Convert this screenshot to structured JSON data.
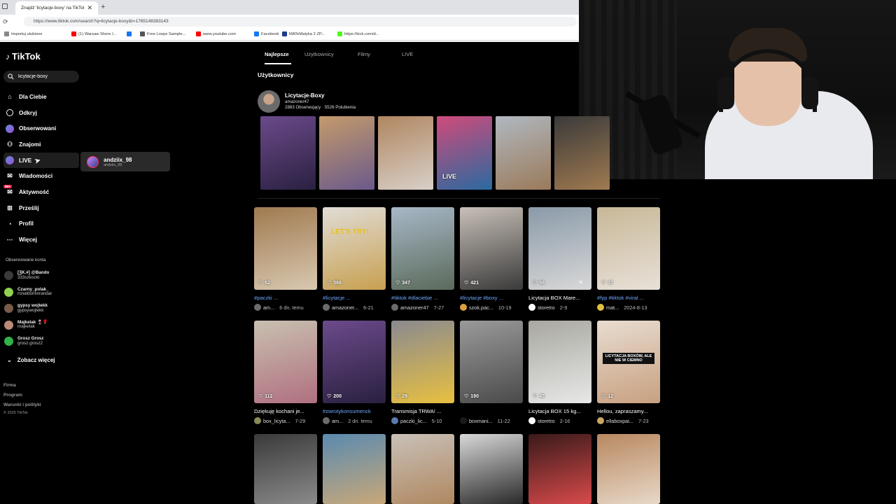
{
  "browser": {
    "tab_title": "Znajdź 'licytacje-boxy' na TikTok |",
    "tab_close": "✕",
    "new_tab": "+",
    "reload": "⟳",
    "url": "https://www.tiktok.com/search?q=licytacje-boxy&t=1765148383143",
    "bookmarks": [
      {
        "label": "Importuj ulubione",
        "color": "#888888"
      },
      {
        "label": "(1) Warsaw Shore I...",
        "color": "#ff0000"
      },
      {
        "label": "",
        "color": "#1877f2"
      },
      {
        "label": "Free Loops Sample...",
        "color": "#555555"
      },
      {
        "label": "www.youtube.com",
        "color": "#ff0000"
      },
      {
        "label": "Facebook",
        "color": "#1877f2"
      },
      {
        "label": "MATeMatyka 2 ZP...",
        "color": "#1a3d8f"
      },
      {
        "label": "https://kick.com/d...",
        "color": "#53fc18"
      }
    ]
  },
  "app": {
    "name": "TikTok",
    "search_value": "licytacje-boxy"
  },
  "sidebar": {
    "nav": [
      {
        "label": "Dla Ciebie",
        "icon": "home-icon"
      },
      {
        "label": "Odkryj",
        "icon": "compass-icon"
      },
      {
        "label": "Obserwowani",
        "icon": "avatar-icon"
      },
      {
        "label": "Znajomi",
        "icon": "friends-icon"
      },
      {
        "label": "LIVE",
        "icon": "live-icon"
      },
      {
        "label": "Wiadomości",
        "icon": "messages-icon"
      },
      {
        "label": "Aktywność",
        "icon": "activity-icon",
        "badge": "99+"
      },
      {
        "label": "Prześlij",
        "icon": "upload-icon"
      },
      {
        "label": "Profil",
        "icon": "profile-icon"
      },
      {
        "label": "Więcej",
        "icon": "more-icon"
      }
    ],
    "live_popup": {
      "name": "andziix_98",
      "user": "andziix_98"
    },
    "following_title": "Obserwowane konta",
    "following": [
      {
        "name": "[ƷK.#] @Bando",
        "user": "333szkocki",
        "color": "#3a3a3a"
      },
      {
        "name": "Czarny_polak_",
        "user": "ronaldominrandar",
        "color": "#8fd14f"
      },
      {
        "name": "gypsy wojtekk",
        "user": "gypsywojtekk",
        "color": "#7a5a4a"
      },
      {
        "name": "Majkelak 🍷🌹",
        "user": "majkelak",
        "color": "#b98a78"
      },
      {
        "name": "Grosz Grosz",
        "user": "grosz.grosz2",
        "color": "#2fb34a"
      }
    ],
    "see_more": "Zobacz więcej",
    "footer": [
      "Firma",
      "Program",
      "Warunki i polityki"
    ],
    "copyright": "© 2025 TikTok"
  },
  "main": {
    "tabs": [
      "Najlepsze",
      "Użytkownicy",
      "Filmy",
      "LIVE"
    ],
    "section_title": "Użytkownicy",
    "user": {
      "name": "Licytacje-Boxy",
      "handle": "amazoner47",
      "stats": "2883 Obserwujący · 5526 Polubienia"
    },
    "strip": [
      {
        "colors": [
          "#6b4a8a",
          "#2a2040"
        ],
        "live": ""
      },
      {
        "colors": [
          "#c49a6c",
          "#6a5a8a"
        ],
        "live": ""
      },
      {
        "colors": [
          "#b08660",
          "#d8d0c8"
        ],
        "live": ""
      },
      {
        "colors": [
          "#d04a7a",
          "#2a6aa0"
        ],
        "live": "LIVE"
      },
      {
        "colors": [
          "#b0b8c0",
          "#9a7a5a"
        ],
        "live": ""
      },
      {
        "colors": [
          "#3a3a3a",
          "#a07a50"
        ],
        "live": ""
      }
    ],
    "videos": [
      {
        "likes": "62",
        "title": "#paczki ...",
        "author": "am...",
        "date": "6 dn. temu",
        "colors": [
          "#a07a50",
          "#d8c8b0"
        ],
        "avatar": "#6b6b6b"
      },
      {
        "likes": "568",
        "title": "#licytacje ...",
        "author": "amazoner...",
        "date": "6-21",
        "colors": [
          "#e0dcd6",
          "#c8a050"
        ],
        "avatar": "#6b6b6b",
        "overlay": "LET'S TRY!"
      },
      {
        "likes": "347",
        "title": "#tiktok #dlaciebie ...",
        "author": "amazoner47",
        "date": "7-27",
        "colors": [
          "#a8b8c8",
          "#5a6a5a"
        ],
        "avatar": "#6b6b6b"
      },
      {
        "likes": "421",
        "title": "#licytacje #boxy ...",
        "author": "szok.pac...",
        "date": "10-19",
        "colors": [
          "#c8c0b8",
          "#3a3a3a"
        ],
        "avatar": "#d8a040"
      },
      {
        "likes": "58",
        "title": "Licytacja BOX Mare...",
        "author": "storetro",
        "date": "2-9",
        "colors": [
          "#8a9aa8",
          "#d8d8d8"
        ],
        "avatar": "#ffffff",
        "mute": true
      },
      {
        "likes": "37",
        "title": "#fyp #tiktok #viral ...",
        "author": "mat...",
        "date": "2024-8-13",
        "colors": [
          "#c8b898",
          "#e8e0d8"
        ],
        "avatar": "#e0c040"
      },
      {
        "likes": "112",
        "title": "Dziękuję kochani je...",
        "author": "box_licyta...",
        "date": "7-29",
        "colors": [
          "#c8c0b0",
          "#b07080"
        ],
        "avatar": "#8a8a5a"
      },
      {
        "likes": "200",
        "title": "#zwrotykonsumenck",
        "author": "am...",
        "date": "2 dn. temu",
        "colors": [
          "#6b4a8a",
          "#2a2040"
        ],
        "avatar": "#6b6b6b",
        "blue": true
      },
      {
        "likes": "29",
        "title": "Transmisja TRWA! ...",
        "author": "paczki_lic...",
        "date": "5-10",
        "colors": [
          "#8a8a90",
          "#e8c040"
        ],
        "avatar": "#5a7ab0"
      },
      {
        "likes": "190",
        "title": "",
        "author": "boxmani...",
        "date": "11-22",
        "colors": [
          "#9a9a9a",
          "#4a4a4a"
        ],
        "avatar": "#1a1a1a"
      },
      {
        "likes": "45",
        "title": "Licytacja BOX 15 kg...",
        "author": "storetro",
        "date": "2-16",
        "colors": [
          "#a8a8a0",
          "#e8e8e8"
        ],
        "avatar": "#ffffff"
      },
      {
        "likes": "12",
        "title": "Hellou, zapraszamy...",
        "author": "ellaboxpai...",
        "date": "7-23",
        "colors": [
          "#e8dcd0",
          "#c8a080"
        ],
        "avatar": "#c8a860",
        "overlay": "LICYTACJA BOXÓW, ALE NIE W CIEMNO"
      },
      {
        "likes": "",
        "title": "",
        "author": "",
        "date": "",
        "colors": [
          "#3a3a3a",
          "#8a8a8a"
        ],
        "avatar": ""
      },
      {
        "likes": "",
        "title": "",
        "author": "",
        "date": "",
        "colors": [
          "#5a8ab0",
          "#c8a878"
        ],
        "avatar": ""
      },
      {
        "likes": "",
        "title": "",
        "author": "",
        "date": "",
        "colors": [
          "#c8c0b8",
          "#b08860"
        ],
        "avatar": ""
      },
      {
        "likes": "",
        "title": "",
        "author": "",
        "date": "",
        "colors": [
          "#d8d8d8",
          "#2a2a2a"
        ],
        "avatar": ""
      },
      {
        "likes": "",
        "title": "",
        "author": "",
        "date": "",
        "colors": [
          "#3a1a1a",
          "#d84a4a"
        ],
        "avatar": ""
      },
      {
        "likes": "",
        "title": "",
        "author": "",
        "date": "",
        "colors": [
          "#b88860",
          "#e8d8c8"
        ],
        "avatar": ""
      }
    ]
  },
  "colors": {
    "accent": "#fe2c55",
    "bg": "#000000"
  }
}
